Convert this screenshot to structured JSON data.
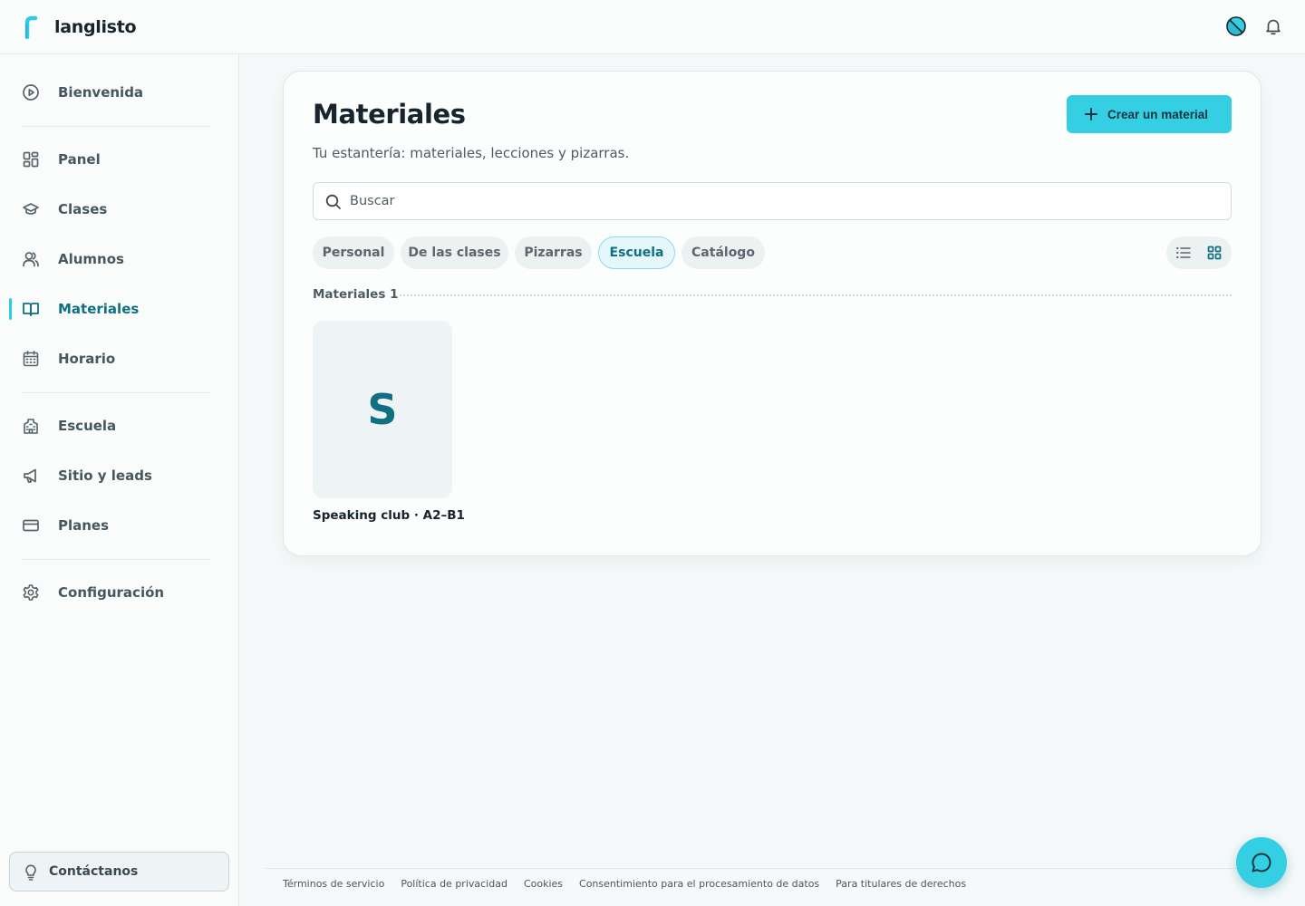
{
  "app": {
    "name": "langlisto"
  },
  "header": {
    "theme_icon": "theme-toggle-icon",
    "notification_icon": "bell-icon"
  },
  "sidebar": {
    "items": [
      {
        "label": "Bienvenida",
        "icon": "play-circle-icon"
      },
      {
        "label": "Panel",
        "icon": "dashboard-icon"
      },
      {
        "label": "Clases",
        "icon": "graduation-cap-icon"
      },
      {
        "label": "Alumnos",
        "icon": "users-icon"
      },
      {
        "label": "Materiales",
        "icon": "book-open-icon",
        "active": true
      },
      {
        "label": "Horario",
        "icon": "calendar-icon"
      },
      {
        "label": "Escuela",
        "icon": "building-icon"
      },
      {
        "label": "Sitio y leads",
        "icon": "megaphone-icon"
      },
      {
        "label": "Planes",
        "icon": "credit-card-icon"
      },
      {
        "label": "Configuración",
        "icon": "gear-icon"
      }
    ],
    "contact_label": "Contáctanos"
  },
  "main": {
    "title": "Materiales",
    "subtitle": "Tu estantería: materiales, lecciones y pizarras.",
    "create_button": "Crear un material",
    "search_placeholder": "Buscar",
    "filters": [
      {
        "label": "Personal",
        "active": false
      },
      {
        "label": "De las clases",
        "active": false
      },
      {
        "label": "Pizarras",
        "active": false
      },
      {
        "label": "Escuela",
        "active": true
      },
      {
        "label": "Catálogo",
        "active": false
      }
    ],
    "view_mode": "grid",
    "section_label": "Materiales 1",
    "materials": [
      {
        "initial": "S",
        "title": "Speaking club · A2–B1"
      }
    ]
  },
  "footer": {
    "links": [
      "Términos de servicio",
      "Política de privacidad",
      "Cookies",
      "Consentimiento para el procesamiento de datos",
      "Para titulares de derechos"
    ]
  },
  "colors": {
    "accent": "#35cfe3",
    "accent_dark": "#116f82",
    "text": "#17242d"
  }
}
